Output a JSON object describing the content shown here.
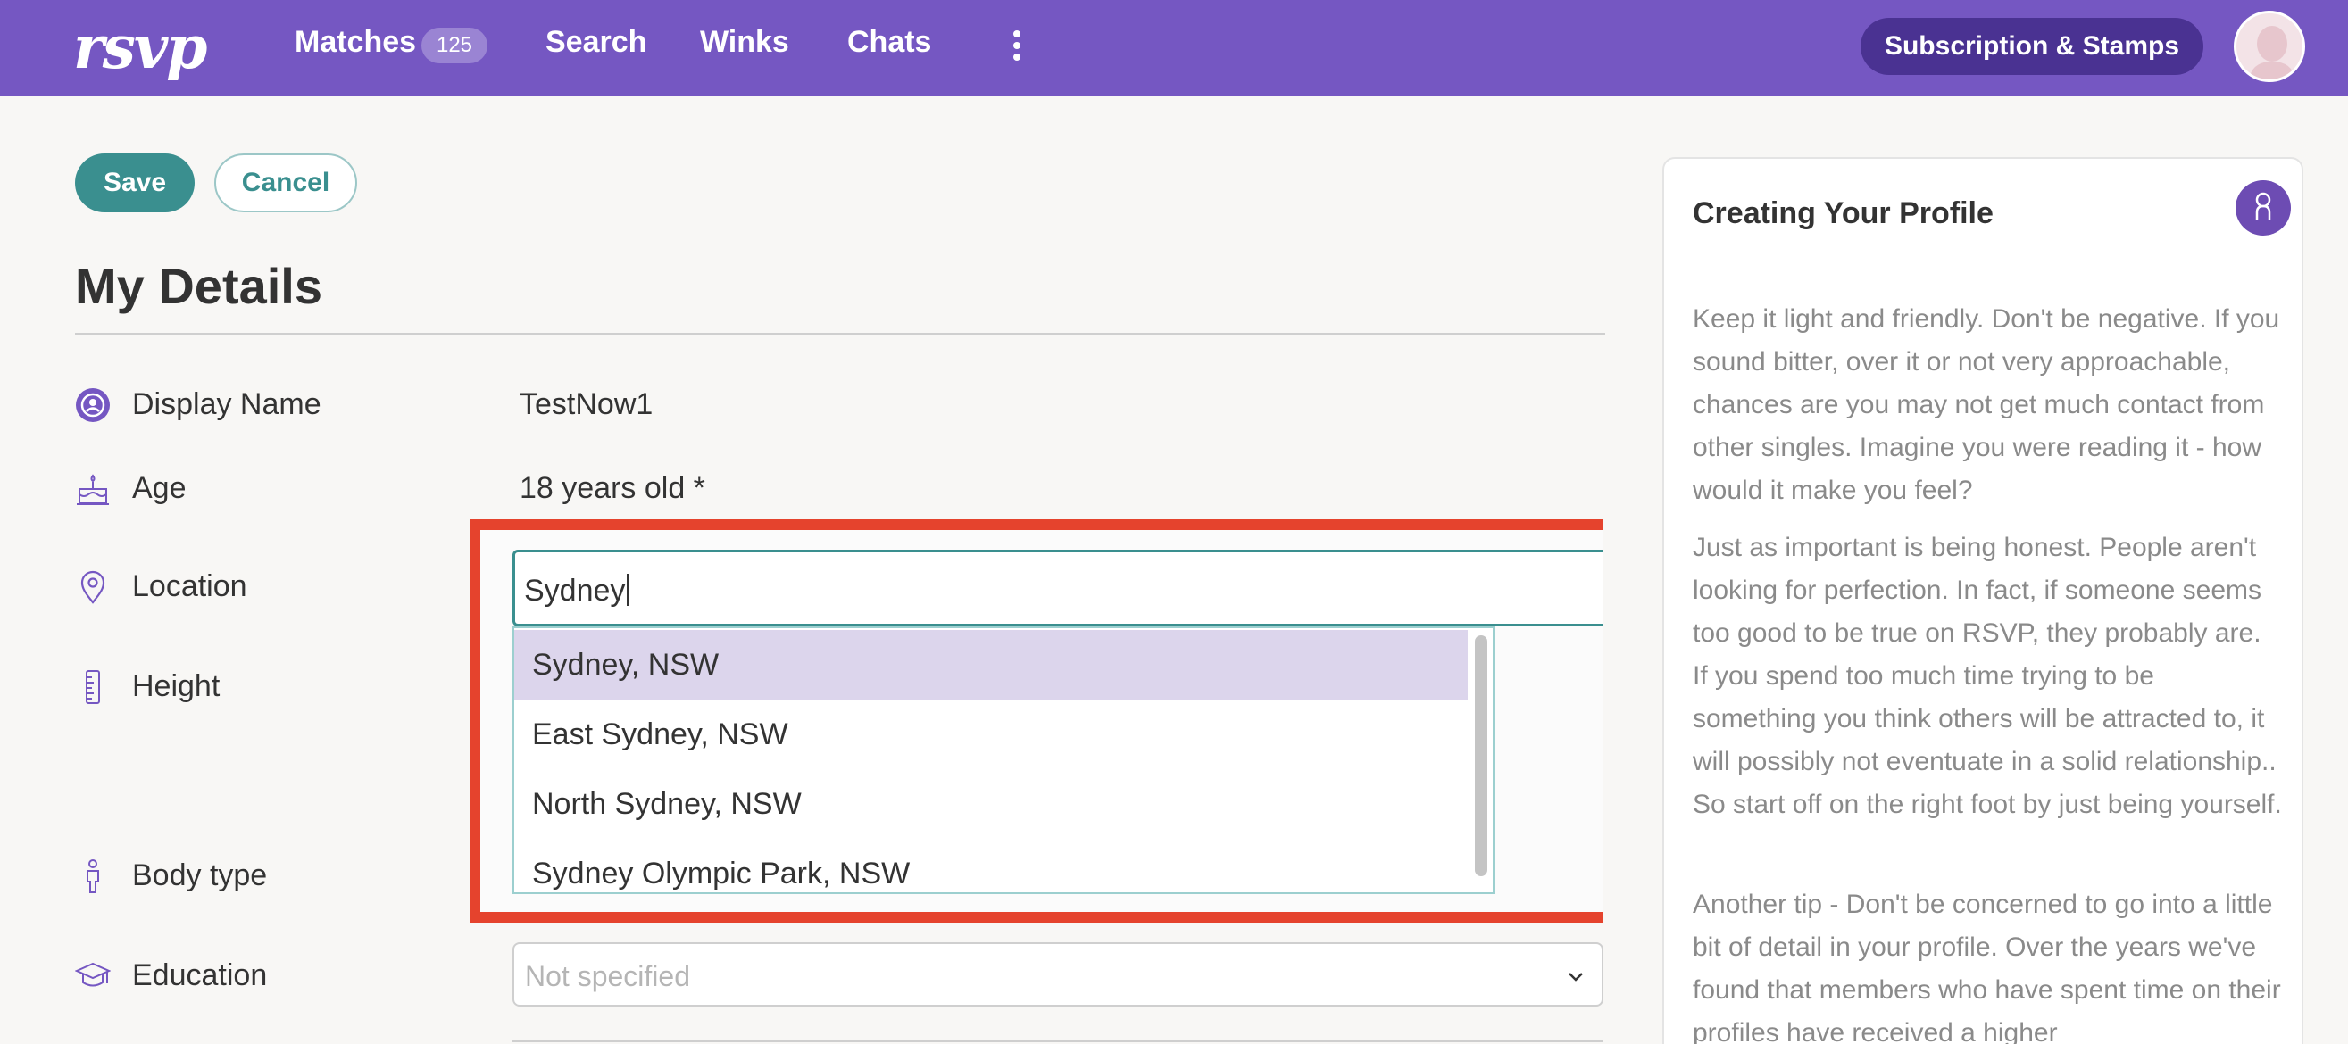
{
  "nav": {
    "logo": "rsvp",
    "matches_label": "Matches",
    "matches_count": "125",
    "search_label": "Search",
    "winks_label": "Winks",
    "chats_label": "Chats",
    "subscription_label": "Subscription & Stamps"
  },
  "actions": {
    "save_label": "Save",
    "cancel_label": "Cancel"
  },
  "page_title": "My Details",
  "rows": {
    "display_name": {
      "label": "Display Name",
      "value": "TestNow1"
    },
    "age": {
      "label": "Age",
      "value": "18 years old *"
    },
    "location": {
      "label": "Location",
      "value": "Sydney",
      "options": [
        "Sydney, NSW",
        "East Sydney, NSW",
        "North Sydney, NSW",
        "Sydney Olympic Park, NSW"
      ],
      "selected_index": 0
    },
    "height": {
      "label": "Height"
    },
    "body_type": {
      "label": "Body type"
    },
    "education": {
      "label": "Education",
      "placeholder": "Not specified"
    }
  },
  "panel": {
    "title": "Creating Your Profile",
    "paragraphs": [
      "Keep it light and friendly. Don't be negative. If you sound bitter, over it or not very approachable, chances are you may not get much contact from other singles. Imagine you were reading it - how would it make you feel?",
      "Just as important is being honest. People aren't looking for perfection. In fact, if someone seems too good to be true on RSVP, they probably are. If you spend too much time trying to be something you think others will be attracted to, it will possibly not eventuate in a solid relationship.. So start off on the right foot by just being yourself.",
      "Another tip - Don't be concerned to go into a little bit of detail in your profile. Over the years we've found that members who have spent time on their profiles have received a higher"
    ]
  },
  "colors": {
    "nav_bg": "#7557c2",
    "accent_teal": "#3a8f8f",
    "highlight_red": "#e5432d",
    "selected_option_bg": "#dcd5ec"
  }
}
